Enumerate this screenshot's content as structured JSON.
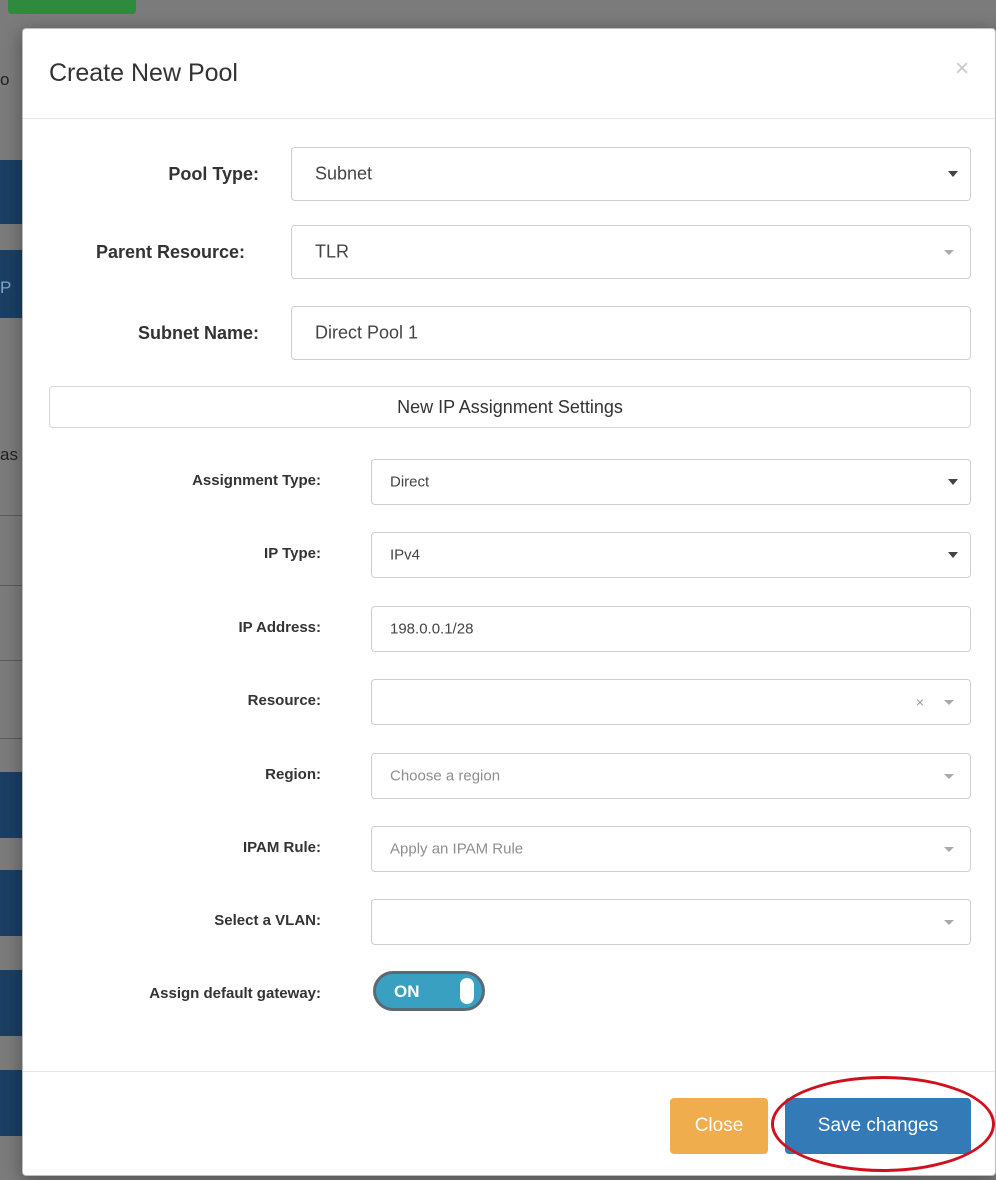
{
  "modal": {
    "title": "Create New Pool",
    "close_symbol": "×"
  },
  "form": {
    "pool_type": {
      "label": "Pool Type:",
      "value": "Subnet"
    },
    "parent_resource": {
      "label": "Parent Resource:",
      "value": "TLR"
    },
    "subnet_name": {
      "label": "Subnet Name:",
      "value": "Direct Pool 1"
    },
    "section_title": "New IP Assignment Settings",
    "assignment_type": {
      "label": "Assignment Type:",
      "value": "Direct"
    },
    "ip_type": {
      "label": "IP Type:",
      "value": "IPv4"
    },
    "ip_address": {
      "label": "IP Address:",
      "value": "198.0.0.1/28"
    },
    "resource": {
      "label": "Resource:",
      "value": "",
      "clear_symbol": "×"
    },
    "region": {
      "label": "Region:",
      "placeholder": "Choose a region"
    },
    "ipam_rule": {
      "label": "IPAM Rule:",
      "placeholder": "Apply an IPAM Rule"
    },
    "vlan": {
      "label": "Select a VLAN:",
      "value": ""
    },
    "default_gateway": {
      "label": "Assign default gateway:",
      "toggle_text": "ON",
      "enabled": true
    }
  },
  "footer": {
    "close_label": "Close",
    "save_label": "Save changes"
  },
  "background": {
    "fragments": [
      "o",
      "P",
      "as"
    ]
  },
  "colors": {
    "primary": "#337ab7",
    "warning": "#f0ad4e",
    "toggle_on": "#3aa0c2",
    "annotation": "#d0101c"
  }
}
